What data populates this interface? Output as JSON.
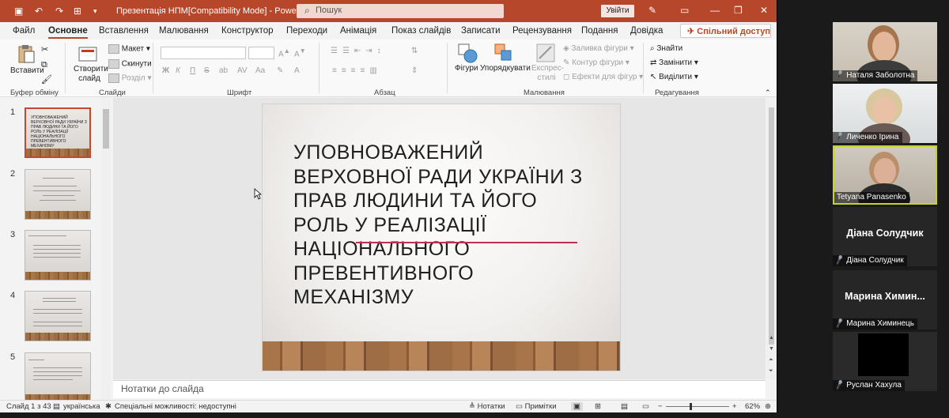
{
  "titlebar": {
    "document_title": "Презентація НПМ[Compatibility Mode]  -  PowerP...",
    "search_placeholder": "Пошук",
    "signin_label": "Увійти"
  },
  "tabs": [
    "Файл",
    "Основне",
    "Вставлення",
    "Малювання",
    "Конструктор",
    "Переходи",
    "Анімація",
    "Показ слайдів",
    "Записати",
    "Рецензування",
    "Подання",
    "Довідка"
  ],
  "active_tab": "Основне",
  "share_label": "Спільний доступ",
  "ribbon": {
    "clipboard": {
      "paste": "Вставити",
      "group": "Буфер обміну"
    },
    "slides": {
      "new_slide": "Створити слайд",
      "layout": "Макет",
      "reset": "Скинути",
      "section": "Розділ",
      "group": "Слайди"
    },
    "font": {
      "group": "Шрифт",
      "bold": "Ж",
      "italic": "К",
      "underline": "П",
      "strike": "S"
    },
    "paragraph": {
      "group": "Абзац"
    },
    "drawing": {
      "shapes": "Фігури",
      "arrange": "Упорядкувати",
      "quick_styles": "Експрес-стилі",
      "fill": "Заливка фігури",
      "outline": "Контур фігури",
      "effects": "Ефекти для фігур",
      "group": "Малювання"
    },
    "editing": {
      "find": "Знайти",
      "replace": "Замінити",
      "select": "Виділити",
      "group": "Редагування"
    }
  },
  "thumbnails": [
    {
      "num": "1",
      "title": "УПОВНОВАЖЕНИЙ ВЕРХОВНОЇ РАДИ УКРАЇНИ З ПРАВ ЛЮДИНИ ТА ЙОГО РОЛЬ У РЕАЛІЗАЦІЇ НАЦІОНАЛЬНОГО ПРЕВЕНТИВНОГО МЕХАНІЗМУ",
      "selected": true
    },
    {
      "num": "2",
      "title": "",
      "selected": false
    },
    {
      "num": "3",
      "title": "",
      "selected": false
    },
    {
      "num": "4",
      "title": "",
      "selected": false
    },
    {
      "num": "5",
      "title": "",
      "selected": false
    }
  ],
  "slide": {
    "title_lines": [
      "УПОВНОВАЖЕНИЙ",
      "ВЕРХОВНОЇ РАДИ УКРАЇНИ З",
      "ПРАВ ЛЮДИНИ ТА ЙОГО",
      "РОЛЬ У РЕАЛІЗАЦІЇ",
      "НАЦІОНАЛЬНОГО",
      "ПРЕВЕНТИВНОГО",
      "МЕХАНІЗМУ"
    ]
  },
  "notes_placeholder": "Нотатки до слайда",
  "status": {
    "slide_count": "Слайд 1 з 43",
    "language": "українська",
    "accessibility": "Спеціальні можливості: недоступні",
    "notes_btn": "Нотатки",
    "comments_btn": "Примітки",
    "zoom": "62%"
  },
  "participants": [
    {
      "name": "Наталя Заболотна",
      "big_name": "",
      "muted": true,
      "video": true,
      "active": false
    },
    {
      "name": "Личенко Ірина",
      "big_name": "",
      "muted": true,
      "video": true,
      "active": false
    },
    {
      "name": "Tetyana Panasenko",
      "big_name": "",
      "muted": false,
      "video": true,
      "active": true
    },
    {
      "name": "Діана Солудчик",
      "big_name": "Діана Солудчик",
      "muted": true,
      "video": false,
      "active": false
    },
    {
      "name": "Марина Химинець",
      "big_name": "Марина Химин...",
      "muted": true,
      "video": false,
      "active": false
    },
    {
      "name": "Руслан Хахула",
      "big_name": "",
      "muted": true,
      "video": false,
      "active": false
    }
  ],
  "colors": {
    "accent": "#b7472a",
    "active_border": "#c7d32a",
    "title_underline": "#c0304a"
  }
}
